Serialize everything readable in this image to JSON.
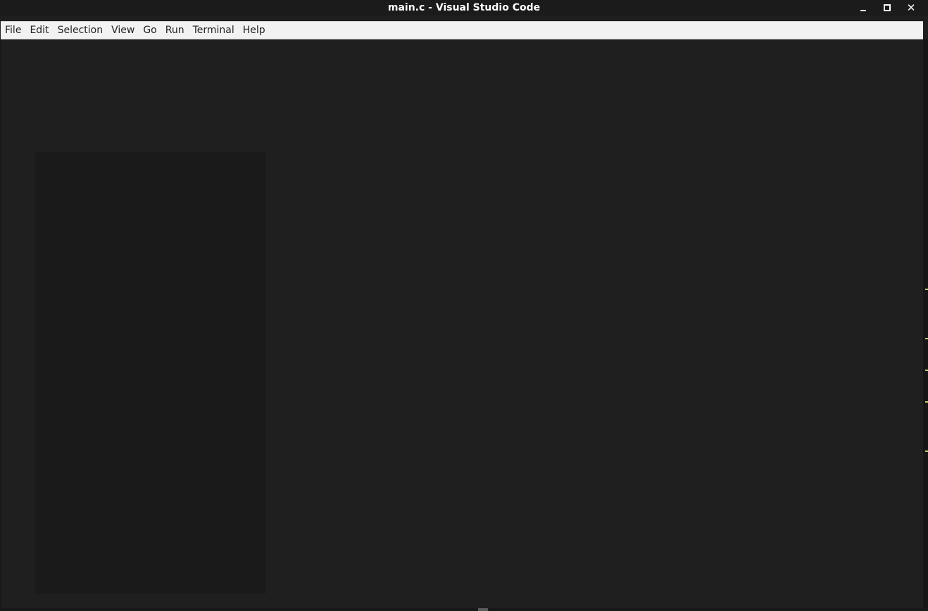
{
  "window": {
    "title": "main.c - Visual Studio Code"
  },
  "menubar": {
    "items": [
      {
        "label": "File"
      },
      {
        "label": "Edit"
      },
      {
        "label": "Selection"
      },
      {
        "label": "View"
      },
      {
        "label": "Go"
      },
      {
        "label": "Run"
      },
      {
        "label": "Terminal"
      },
      {
        "label": "Help"
      }
    ]
  },
  "icons": {
    "minimize": "minimize-icon",
    "maximize": "maximize-icon",
    "close": "close-icon"
  },
  "colors": {
    "titlebar_bg": "#1b1b1b",
    "menubar_bg": "#f2f2f2",
    "editor_bg": "#1f1f1f",
    "panel_bg": "#1a1a1a"
  }
}
